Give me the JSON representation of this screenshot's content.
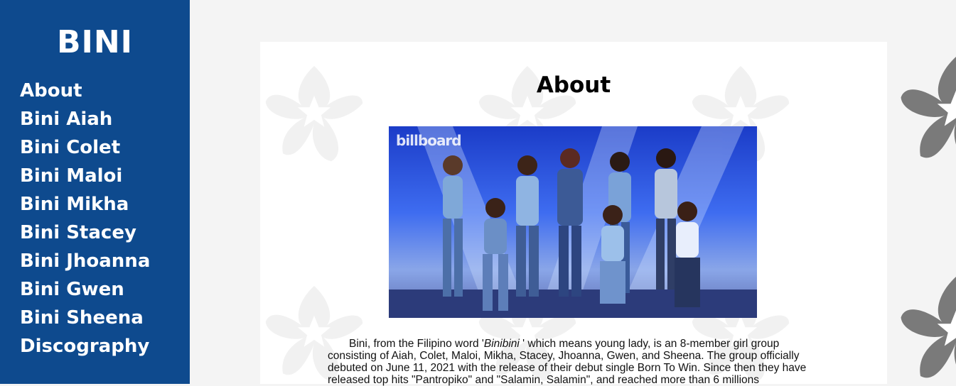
{
  "sidebar": {
    "logo": "BINI",
    "nav": [
      {
        "label": "About"
      },
      {
        "label": "Bini Aiah"
      },
      {
        "label": "Bini Colet"
      },
      {
        "label": "Bini Maloi"
      },
      {
        "label": "Bini Mikha"
      },
      {
        "label": "Bini Stacey"
      },
      {
        "label": "Bini Jhoanna"
      },
      {
        "label": "Bini Gwen"
      },
      {
        "label": "Bini Sheena"
      },
      {
        "label": "Discography"
      }
    ]
  },
  "main": {
    "heading": "About",
    "photo": {
      "watermark": "billboard",
      "alt_icon": "group-photo"
    },
    "paragraph": {
      "before": "Bini, from the Filipino word '",
      "emphasis": "Binibini",
      "after": " ' which means young lady, is an 8-member girl group consisting of Aiah, Colet, Maloi, Mikha, Stacey, Jhoanna, Gwen, and Sheena. The group officially debuted on June 11, 2021 with the release of their debut single Born To Win. Since then they have released top hits \"Pantropiko\" and \"Salamin, Salamin\", and reached more than 6 millions"
    }
  },
  "colors": {
    "sidebar_bg": "#0e4a8e",
    "page_bg": "#f4f4f4",
    "card_bg": "#ffffff",
    "flower_dark": "#7a7a7a",
    "flower_light": "#f2f2f2"
  }
}
